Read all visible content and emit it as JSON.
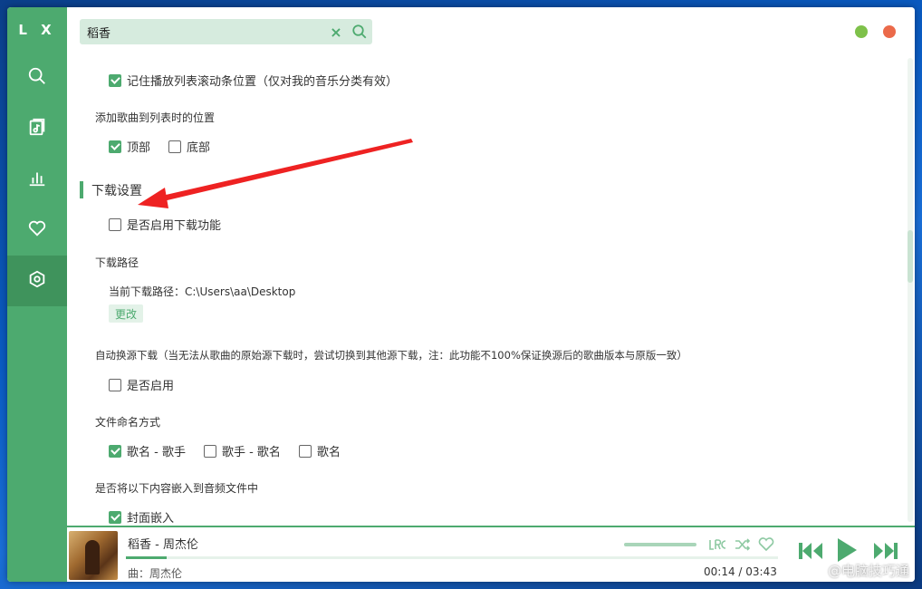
{
  "app": {
    "logo": "L X"
  },
  "sidebar": {
    "items": [
      {
        "icon": "search-icon"
      },
      {
        "icon": "song-list-icon"
      },
      {
        "icon": "leaderboard-icon"
      },
      {
        "icon": "heart-icon"
      },
      {
        "icon": "settings-icon",
        "active": true
      }
    ]
  },
  "search": {
    "value": "稻香",
    "clear_glyph": "×"
  },
  "settings": {
    "remember_scroll": "记住播放列表滚动条位置（仅对我的音乐分类有效）",
    "add_position_label": "添加歌曲到列表时的位置",
    "add_position_top": "顶部",
    "add_position_bottom": "底部",
    "download_section_title": "下载设置",
    "enable_download": "是否启用下载功能",
    "download_path_label": "下载路径",
    "current_path": "当前下载路径：C:\\Users\\aa\\Desktop",
    "change_button": "更改",
    "auto_switch_label": "自动换源下载（当无法从歌曲的原始源下载时，尝试切换到其他源下载，注：此功能不100%保证换源后的歌曲版本与原版一致）",
    "auto_switch_enable": "是否启用",
    "file_naming_label": "文件命名方式",
    "naming_song_singer": "歌名 - 歌手",
    "naming_singer_song": "歌手 - 歌名",
    "naming_song": "歌名",
    "embed_label": "是否将以下内容嵌入到音频文件中",
    "embed_cover": "封面嵌入"
  },
  "player": {
    "title": "稻香 - 周杰伦",
    "singer": "曲：周杰伦",
    "time": "00:14  /  03:43",
    "progress": 0.063
  },
  "watermark": "@电脑技巧通",
  "colors": {
    "accent": "#4daa6f",
    "min_dot": "#7ec14a",
    "close_dot": "#eb6a4a",
    "annotation_arrow": "#ee2222"
  }
}
